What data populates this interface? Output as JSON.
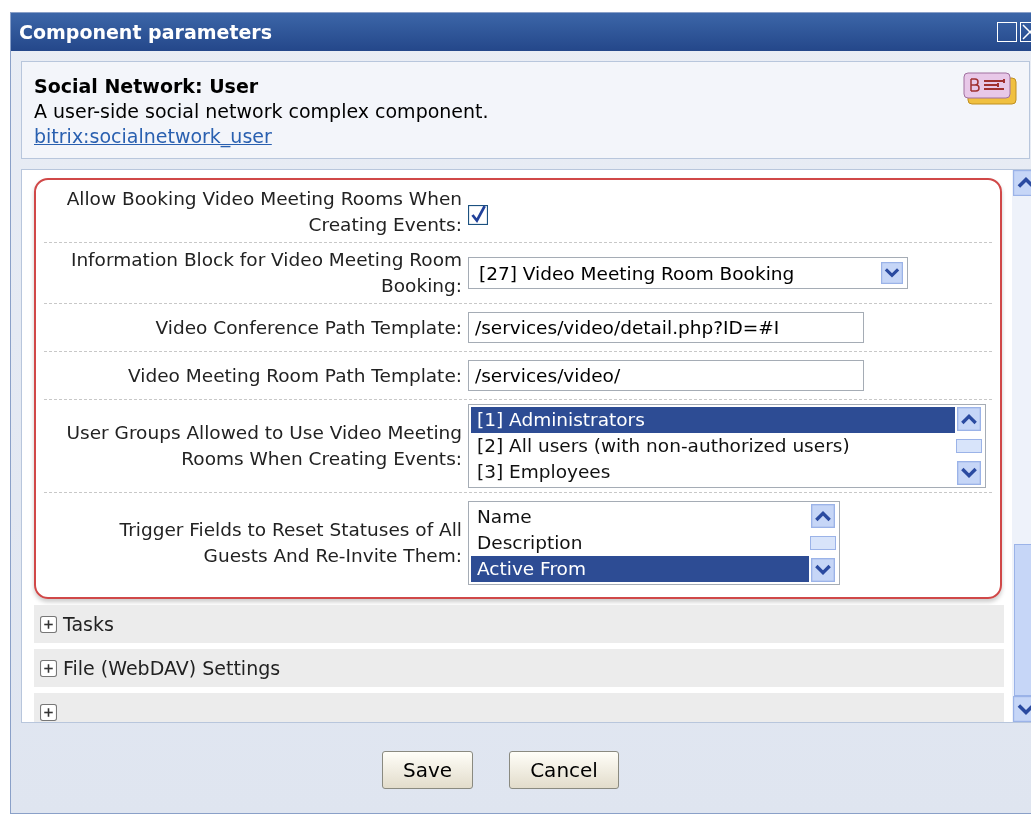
{
  "window": {
    "title": "Component parameters"
  },
  "component": {
    "name": "Social Network: User",
    "description": "A user-side social network complex component.",
    "code": "bitrix:socialnetwork_user"
  },
  "parameters": [
    {
      "kind": "checkbox",
      "label": "Allow Booking Video Meeting Rooms When Creating Events:",
      "checked": true
    },
    {
      "kind": "select",
      "label": "Information Block for Video Meeting Room Booking:",
      "value": "[27] Video Meeting Room Booking"
    },
    {
      "kind": "text",
      "label": "Video Conference Path Template:",
      "value": "/services/video/detail.php?ID=#I"
    },
    {
      "kind": "text",
      "label": "Video Meeting Room Path Template:",
      "value": "/services/video/"
    },
    {
      "kind": "list",
      "label": "User Groups Allowed to Use Video Meeting Rooms When Creating Events:",
      "options": [
        {
          "label": "[1] Administrators",
          "selected": true
        },
        {
          "label": "[2] All users (with non-authorized users)",
          "selected": false
        },
        {
          "label": "[3] Employees",
          "selected": false
        }
      ]
    },
    {
      "kind": "list",
      "label": "Trigger Fields to Reset Statuses of All Guests And Re-Invite Them:",
      "options": [
        {
          "label": "Name",
          "selected": false
        },
        {
          "label": "Description",
          "selected": false
        },
        {
          "label": "Active From",
          "selected": true
        }
      ]
    }
  ],
  "sections": [
    {
      "label": "Tasks",
      "expanded": false
    },
    {
      "label": "File (WebDAV) Settings",
      "expanded": false
    },
    {
      "expanded": false
    }
  ],
  "buttons": [
    "Save",
    "Cancel"
  ]
}
